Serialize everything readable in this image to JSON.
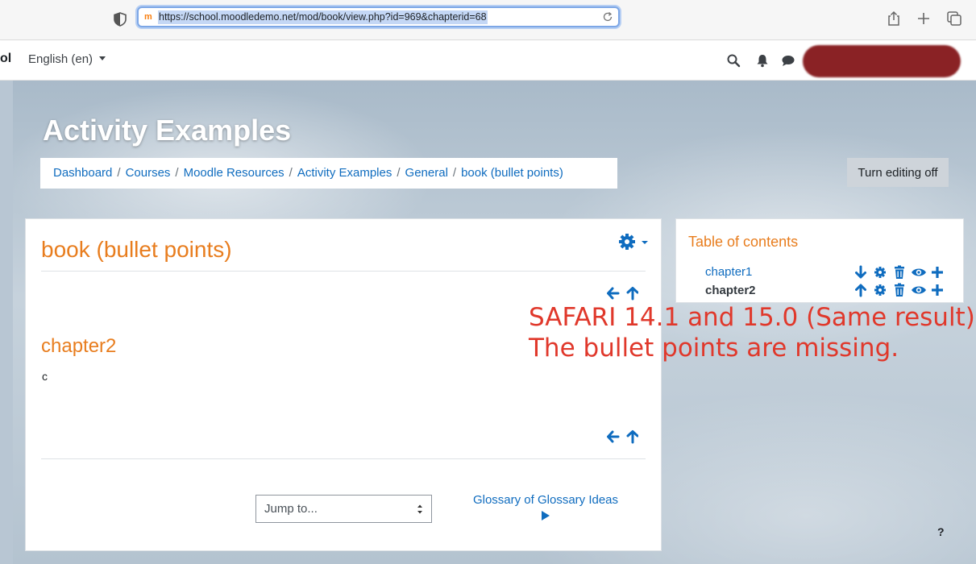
{
  "browser": {
    "url": "https://school.moodledemo.net/mod/book/view.php?id=969&chapterid=68",
    "favicon": "m",
    "icons": [
      "shield-icon",
      "reload-icon",
      "share-icon",
      "new-tab-icon",
      "tabs-overview-icon"
    ]
  },
  "navbar": {
    "site_fragment": "ol",
    "language": "English (en)",
    "icons": [
      "search-icon",
      "bell-icon",
      "chat-icon"
    ]
  },
  "header": {
    "course_title": "Activity Examples",
    "breadcrumb": [
      "Dashboard",
      "Courses",
      "Moodle Resources",
      "Activity Examples",
      "General",
      "book (bullet points)"
    ],
    "breadcrumb_separator": "/",
    "edit_button": "Turn editing off"
  },
  "main": {
    "book_title": "book (bullet points)",
    "chapter_title": "chapter2",
    "chapter_body": "c",
    "jump_placeholder": "Jump to...",
    "next_link": "Glossary of Glossary Ideas"
  },
  "toc": {
    "title": "Table of contents",
    "chapters": [
      {
        "label": "chapter1",
        "current": false
      },
      {
        "label": "chapter2",
        "current": true
      }
    ]
  },
  "annotation": {
    "line1": "SAFARI 14.1 and 15.0 (Same result)",
    "line2": "The bullet points are missing."
  },
  "help": "?",
  "colors": {
    "accent_orange": "#e87d1e",
    "link_blue": "#0f6cbf",
    "annotation_red": "#e0382b",
    "redacted": "#8a2225"
  }
}
